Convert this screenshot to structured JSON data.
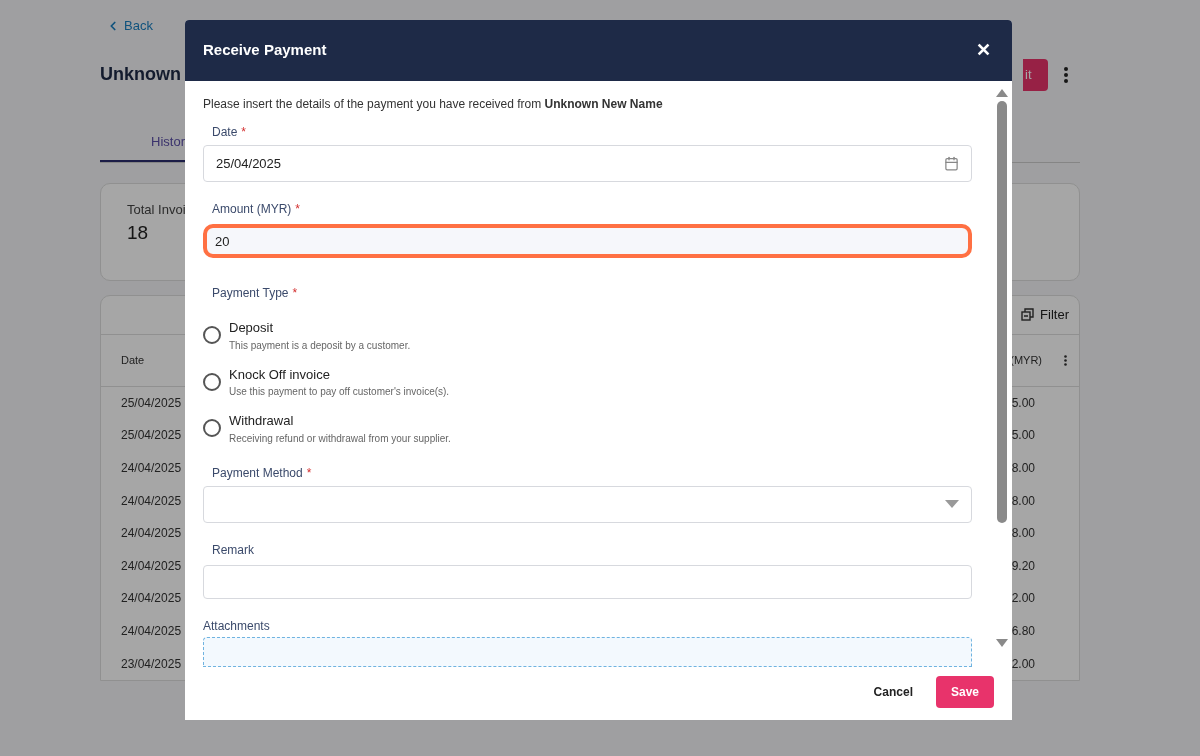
{
  "page": {
    "back": "Back",
    "title": "Unknown",
    "action_button": "it",
    "tab": "Histor",
    "stat": {
      "label": "Total Invoi",
      "value": "18"
    },
    "table": {
      "filter": "Filter",
      "columns": [
        "Date",
        "(MYR)"
      ],
      "rows": [
        {
          "date": "25/04/2025",
          "amount": "5.00"
        },
        {
          "date": "25/04/2025",
          "amount": "5.00"
        },
        {
          "date": "24/04/2025",
          "amount": "8.00"
        },
        {
          "date": "24/04/2025",
          "amount": "8.00"
        },
        {
          "date": "24/04/2025",
          "amount": "8.00"
        },
        {
          "date": "24/04/2025",
          "amount": "9.20"
        },
        {
          "date": "24/04/2025",
          "amount": "2.00"
        },
        {
          "date": "24/04/2025",
          "amount": "6.80"
        },
        {
          "date": "23/04/2025",
          "amount": "2.00"
        }
      ]
    }
  },
  "dialog": {
    "title": "Receive Payment",
    "close": "✕",
    "intro": "Please insert the details of the payment you have received from **Unknown New Name**",
    "fields": [
      {
        "kind": "date",
        "label": "Date",
        "required_mark": "*",
        "value": "25/04/2025",
        "highlighted": false
      },
      {
        "kind": "text",
        "label": "Amount (MYR)",
        "required_mark": "*",
        "value": "20",
        "highlighted": true
      },
      {
        "kind": "radio",
        "label": "Payment Type",
        "required_mark": "*",
        "options": [
          {
            "label": "Deposit",
            "description": "This payment is a deposit by a customer.",
            "selected": false
          },
          {
            "label": "Knock Off invoice",
            "description": "Use this payment to pay off customer's invoice(s).",
            "selected": false
          },
          {
            "label": "Withdrawal",
            "description": "Receiving refund or withdrawal from your supplier.",
            "selected": false
          }
        ]
      },
      {
        "kind": "select",
        "label": "Payment Method",
        "required_mark": "*",
        "highlighted": false
      },
      {
        "kind": "text",
        "label": "Remark",
        "highlighted": false
      },
      {
        "kind": "dropzone",
        "label": "Attachments"
      }
    ],
    "buttons": [
      {
        "kind": "secondary",
        "label": "Cancel"
      },
      {
        "kind": "primary",
        "label": "Save"
      }
    ]
  }
}
